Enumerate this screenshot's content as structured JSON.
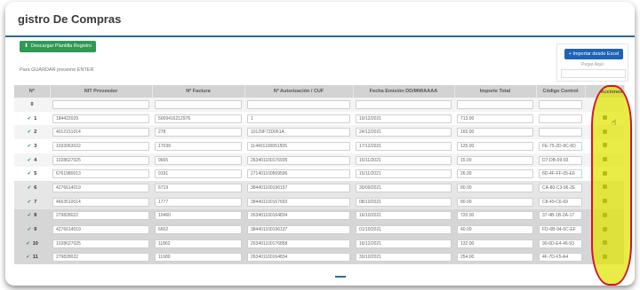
{
  "page": {
    "title": "gistro De Compras"
  },
  "toolbar": {
    "download_label": "Descargar Plantilla Registro",
    "hint": "Para GUARDAR presione ENTER"
  },
  "import": {
    "button_label": "Importar desde Excel",
    "paste_label": "Pegar Aquí"
  },
  "table": {
    "columns": [
      "Nº",
      "NIT Proveedor",
      "Nº Factura",
      "Nº Autorización / CUF",
      "Fecha Emisión DD/MM/AAAA",
      "Importe Total",
      "Código Control",
      "Acciones"
    ],
    "filter_row_number": "0",
    "rows": [
      {
        "num": "1",
        "nit": "184422029",
        "factura": "5009416212976",
        "autorizacion": "1",
        "fecha": "10/12/2021",
        "importe": "713.00",
        "codigo": ""
      },
      {
        "num": "2",
        "nit": "4012151014",
        "factura": "278",
        "autorizacion": "10129F72D061A",
        "fecha": "24/12/2021",
        "importe": "165.00",
        "codigo": ""
      },
      {
        "num": "3",
        "nit": "1033063022",
        "factura": "17039",
        "autorizacion": "114401100051505",
        "fecha": "17/12/2021",
        "importe": "125.00",
        "codigo": "FE-75-2D-9C-6D"
      },
      {
        "num": "4",
        "nit": "1028627025",
        "factura": "9665",
        "autorizacion": "263401100176935",
        "fecha": "15/11/2021",
        "importe": "15.00",
        "codigo": "D7-DB-09-93"
      },
      {
        "num": "5",
        "nit": "6761980013",
        "factura": "9191",
        "autorizacion": "271401100569596",
        "fecha": "15/11/2021",
        "importe": "26.00",
        "codigo": "6D-4F-FF-05-E6"
      },
      {
        "num": "6",
        "nit": "4276614019",
        "factura": "6719",
        "autorizacion": "384401100196157",
        "fecha": "30/09/2021",
        "importe": "80.00",
        "codigo": "CA-80-C3-96-2E"
      },
      {
        "num": "7",
        "nit": "4663510014",
        "factura": "1777",
        "autorizacion": "384401100167693",
        "fecha": "08/10/2021",
        "importe": "80.00",
        "codigo": "C8-49-C6-69"
      },
      {
        "num": "8",
        "nit": "279828022",
        "factura": "10460",
        "autorizacion": "263401100164834",
        "fecha": "16/10/2021",
        "importe": "720.00",
        "codigo": "37-4B-1B-2A-17"
      },
      {
        "num": "9",
        "nit": "4276614019",
        "factura": "6602",
        "autorizacion": "384401100196137",
        "fecha": "01/10/2021",
        "importe": "40.00",
        "codigo": "FD-6B-94-6C-EF"
      },
      {
        "num": "10",
        "nit": "1028627025",
        "factura": "11862",
        "autorizacion": "263401100176858",
        "fecha": "16/12/2021",
        "importe": "132.00",
        "codigo": "90-6D-E4-46-93"
      },
      {
        "num": "11",
        "nit": "279828022",
        "factura": "11680",
        "autorizacion": "263401100164834",
        "fecha": "30/10/2021",
        "importe": "254.00",
        "codigo": "4F-7D-F5-A4"
      }
    ]
  },
  "colors": {
    "accent": "#2c6aa0",
    "download_button": "#2e9a52",
    "import_button": "#1e63b5",
    "highlight_fill": "#e0e400",
    "highlight_border": "#d3142b"
  }
}
